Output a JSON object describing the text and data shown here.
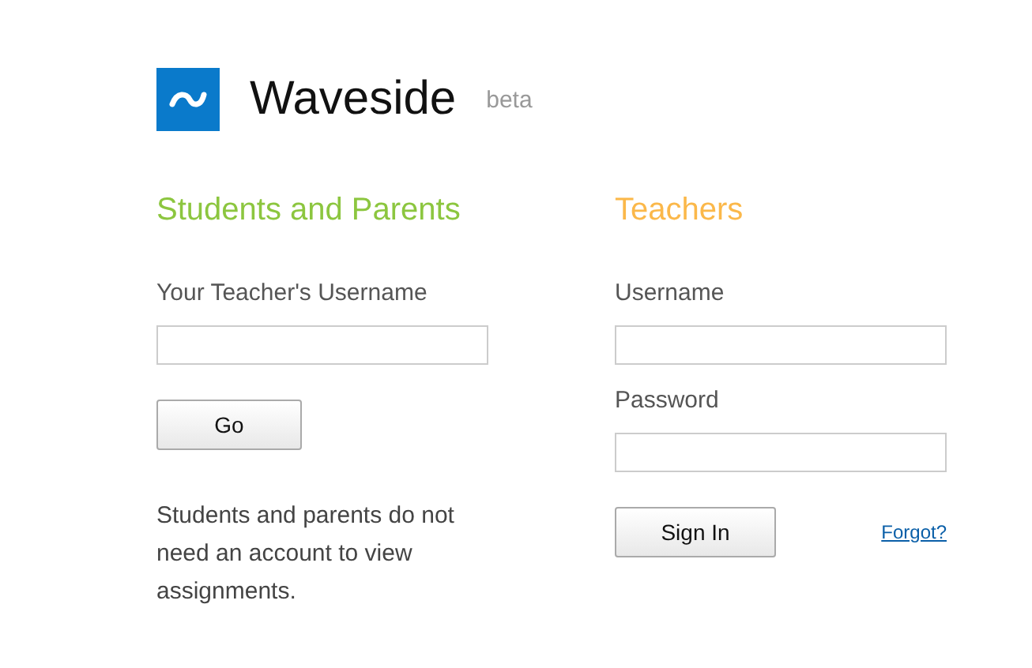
{
  "header": {
    "title": "Waveside",
    "badge": "beta"
  },
  "students": {
    "heading": "Students and Parents",
    "label": "Your Teacher's Username",
    "button": "Go",
    "note": "Students and parents do not need an account to view assignments."
  },
  "teachers": {
    "heading": "Teachers",
    "fields": [
      {
        "label": "Username"
      },
      {
        "label": "Password"
      }
    ],
    "button": "Sign In",
    "link": "Forgot?"
  }
}
